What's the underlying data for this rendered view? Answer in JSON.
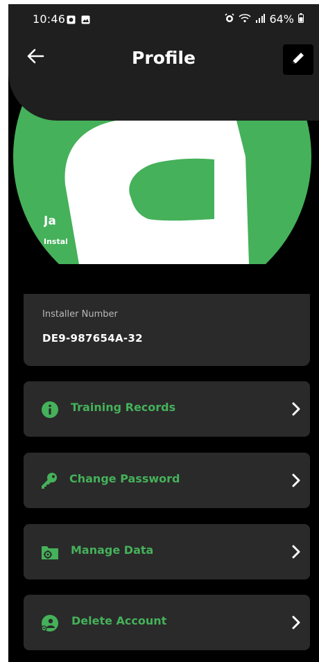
{
  "status_bar": {
    "time": "10:46",
    "battery": "64%"
  },
  "header": {
    "title": "Profile",
    "back_icon": "arrow-left-icon",
    "edit_icon": "pencil-icon"
  },
  "profile": {
    "name": "Ja",
    "role": "Instal"
  },
  "installer": {
    "label": "Installer Number",
    "value": "DE9-987654A-32"
  },
  "menu": [
    {
      "label": "Training Records",
      "icon": "info-icon"
    },
    {
      "label": "Change Password",
      "icon": "key-icon"
    },
    {
      "label": "Manage Data",
      "icon": "folder-gear-icon"
    },
    {
      "label": "Delete Account",
      "icon": "user-remove-icon"
    }
  ],
  "colors": {
    "accent": "#45b15a",
    "header_bg": "#1f1f1f",
    "card_bg": "#2a2a2a",
    "background": "#000000"
  }
}
